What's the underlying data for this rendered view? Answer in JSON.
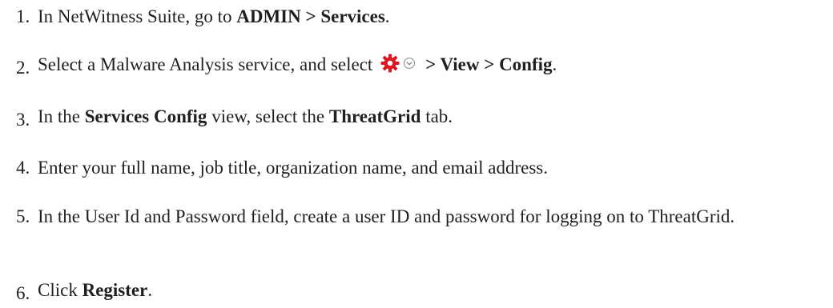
{
  "steps": [
    {
      "number": "1.",
      "parts": [
        "In NetWitness Suite, go to ",
        "ADMIN > Services",
        "."
      ]
    },
    {
      "number": "2.",
      "parts": [
        "Select a Malware Analysis service, and select ",
        "> View > Config",
        "."
      ],
      "icons": [
        "gear-icon",
        "chevron-down-circle-icon"
      ],
      "colors": {
        "gear": "#e0161f"
      }
    },
    {
      "number": "3.",
      "parts": [
        "In the ",
        "Services Config",
        " view, select the ",
        "ThreatGrid",
        " tab."
      ]
    },
    {
      "number": "4.",
      "parts": [
        "Enter your full name, job title, organization name, and email address."
      ]
    },
    {
      "number": "5.",
      "parts": [
        "In the User Id and Password field, create a user ID and password for logging on to ThreatGrid."
      ]
    },
    {
      "number": "6.",
      "parts": [
        "Click ",
        "Register",
        "."
      ]
    }
  ]
}
